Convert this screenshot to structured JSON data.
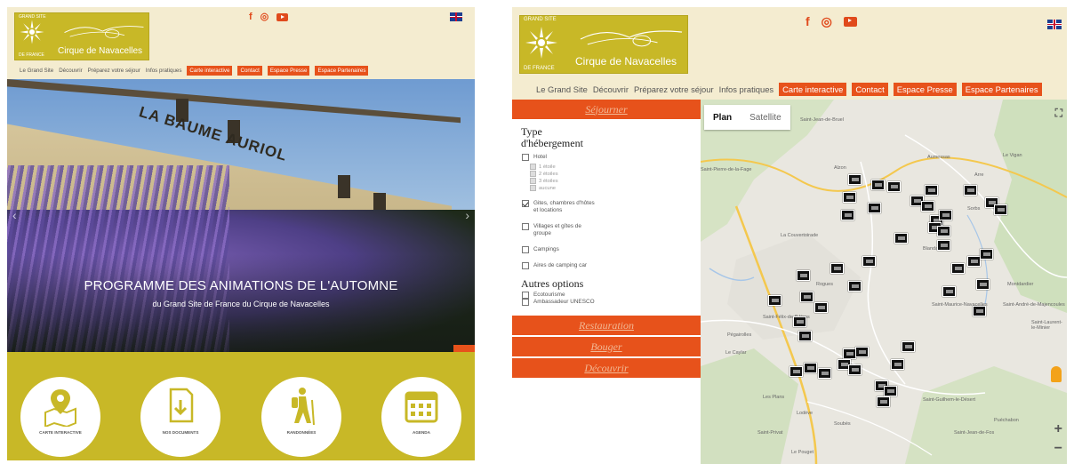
{
  "left": {
    "logo": {
      "tag_top": "GRAND SITE",
      "tag_bottom": "DE FRANCE",
      "name": "Cirque de Navacelles"
    },
    "social": [
      "f",
      "◎"
    ],
    "nav": {
      "plain": [
        "Le Grand Site",
        "Découvrir",
        "Préparez votre séjour",
        "Infos pratiques"
      ],
      "highlight": [
        "Carte interactive",
        "Contact",
        "Espace Presse",
        "Espace Partenaires"
      ]
    },
    "hero": {
      "sign": "LA BAUME AURIOL",
      "title": "PROGRAMME DES ANIMATIONS DE L'AUTOMNE",
      "subtitle": "du Grand Site de France du Cirque de Navacelles"
    },
    "quick_links": [
      {
        "label": "CARTE INTERACTIVE",
        "icon": "map-pin-icon"
      },
      {
        "label": "NOS DOCUMENTS",
        "icon": "document-download-icon"
      },
      {
        "label": "RANDONNÉES",
        "icon": "hiker-icon"
      },
      {
        "label": "AGENDA",
        "icon": "calendar-icon"
      }
    ]
  },
  "right": {
    "logo": {
      "tag_top": "GRAND SITE",
      "tag_bottom": "DE FRANCE",
      "name": "Cirque de Navacelles"
    },
    "social": [
      "f",
      "◎"
    ],
    "nav": {
      "plain": [
        "Le Grand Site",
        "Découvrir",
        "Préparez votre séjour",
        "Infos pratiques"
      ],
      "highlight": [
        "Carte interactive",
        "Contact",
        "Espace Presse",
        "Espace Partenaires"
      ]
    },
    "sidebar": {
      "sejourner": "Séjourner",
      "type_title_1": "Type",
      "type_title_2": "d'hébergement",
      "hotel": "Hotel",
      "hotel_sub": [
        "1 étoile",
        "2 étoiles",
        "3 étoiles",
        "aucune"
      ],
      "gites_1": "Gites, chambres d'hôtes",
      "gites_2": "et locations",
      "villages_1": "Villages et gîtes de",
      "villages_2": "groupe",
      "campings": "Campings",
      "aires": "Aires de camping car",
      "autres_title": "Autres options",
      "ecotourisme": "Ecotourisme",
      "ambassadeur": "Ambassadeur UNESCO",
      "restauration": "Restauration",
      "bouger": "Bouger",
      "decouvrir": "Découvrir"
    },
    "map": {
      "tab_plan": "Plan",
      "tab_satellite": "Satellite",
      "fullscreen": "⛶",
      "zoom_in": "+",
      "zoom_out": "−",
      "labels": [
        "Saint-Jean-de-Bruel",
        "Alzon",
        "Aumessas",
        "Arre",
        "Le Vigan",
        "Saint-Pierre-de-la-Fage",
        "La Couvertoirade",
        "Sorbs",
        "Blandas",
        "Montdardier",
        "Rogues",
        "Saint-Maurice-Navacelles",
        "Saint-André-de-Majencoules",
        "Saint-Laurent-le-Minier",
        "Saint-Félix-de-l'Héras",
        "Pégairolles",
        "Le Caylar",
        "Lodève",
        "Soubès",
        "Les Plans",
        "Saint-Guilhem-le-Désert",
        "Puéchabon",
        "Saint-Jean-de-Fos",
        "Le Pouget",
        "Saint-Privat"
      ]
    }
  }
}
